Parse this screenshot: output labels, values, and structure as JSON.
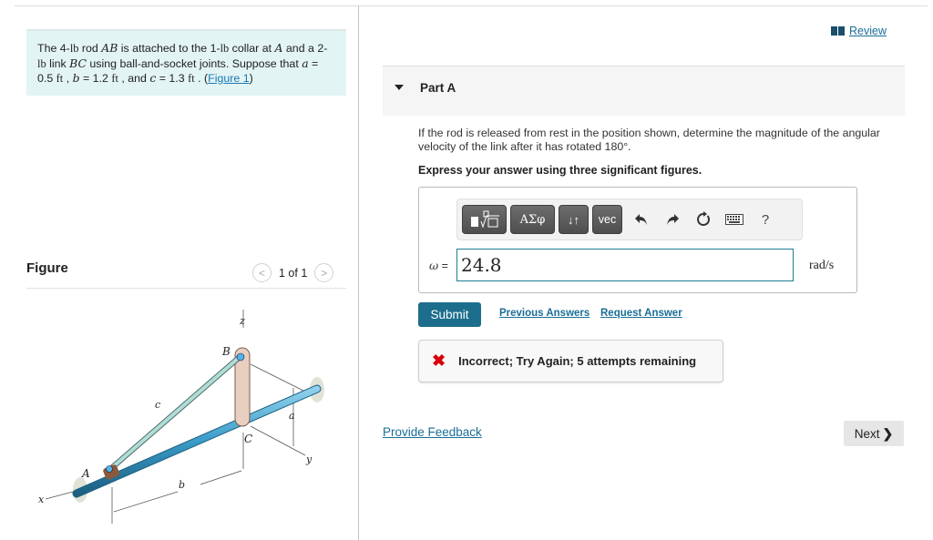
{
  "problem": {
    "segments": [
      {
        "t": "The 4-",
        "c": ""
      },
      {
        "t": "lb",
        "c": "mr"
      },
      {
        "t": " rod ",
        "c": ""
      },
      {
        "t": "AB",
        "c": "m"
      },
      {
        "t": " is attached to the 1-",
        "c": ""
      },
      {
        "t": "lb",
        "c": "mr"
      },
      {
        "t": " collar at ",
        "c": ""
      },
      {
        "t": "A",
        "c": "m"
      },
      {
        "t": " and a 2-",
        "c": ""
      },
      {
        "t": "lb",
        "c": "mr"
      },
      {
        "t": " link ",
        "c": ""
      },
      {
        "t": "BC",
        "c": "m"
      },
      {
        "t": " using ball-and-socket joints. Suppose that ",
        "c": ""
      },
      {
        "t": "a",
        "c": "m"
      },
      {
        "t": " = 0.5 ",
        "c": ""
      },
      {
        "t": "ft",
        "c": "mr"
      },
      {
        "t": " , ",
        "c": ""
      },
      {
        "t": "b",
        "c": "m"
      },
      {
        "t": " = 1.2 ",
        "c": ""
      },
      {
        "t": "ft",
        "c": "mr"
      },
      {
        "t": " , and ",
        "c": ""
      },
      {
        "t": "c",
        "c": "m"
      },
      {
        "t": " = 1.3 ",
        "c": ""
      },
      {
        "t": "ft",
        "c": "mr"
      },
      {
        "t": " . (",
        "c": ""
      }
    ],
    "figure_link": "Figure 1",
    "close_paren": ")"
  },
  "figure": {
    "label": "Figure",
    "counter": "1 of 1",
    "prev_icon": "chevron-left-icon",
    "next_icon": "chevron-right-icon",
    "labels": {
      "x": "x",
      "y": "y",
      "z": "z",
      "A": "A",
      "B": "B",
      "C": "C",
      "a": "a",
      "b": "b",
      "c": "c"
    }
  },
  "review": {
    "icon": "book-icon",
    "label": "Review"
  },
  "part": {
    "label": "Part A",
    "question": "If the rod is released from rest in the position shown, determine the magnitude of the angular velocity of the link after it has rotated 180°.",
    "instruction": "Express your answer using three significant figures."
  },
  "toolbar": {
    "templates": "▮∜□",
    "greek": "ΑΣφ",
    "arrows": "↓↑",
    "vec": "vec",
    "undo_icon": "undo-icon",
    "redo_icon": "redo-icon",
    "reset_icon": "reset-icon",
    "keyboard_icon": "keyboard-icon",
    "help": "?"
  },
  "answer": {
    "variable": "ω",
    "equals": " =",
    "value": "24.8",
    "units": "rad/s"
  },
  "actions": {
    "submit": "Submit",
    "previous_answers": "Previous Answers",
    "request_answer": "Request Answer"
  },
  "feedback": {
    "status": "incorrect",
    "message": "Incorrect; Try Again; 5 attempts remaining"
  },
  "footer": {
    "provide_feedback": "Provide Feedback",
    "next": "Next",
    "next_chevron": "❯"
  },
  "colors": {
    "accent": "#1c6e8c",
    "link": "#1a6e96",
    "error": "#d9000b",
    "problem_bg": "#e3f4f4"
  }
}
